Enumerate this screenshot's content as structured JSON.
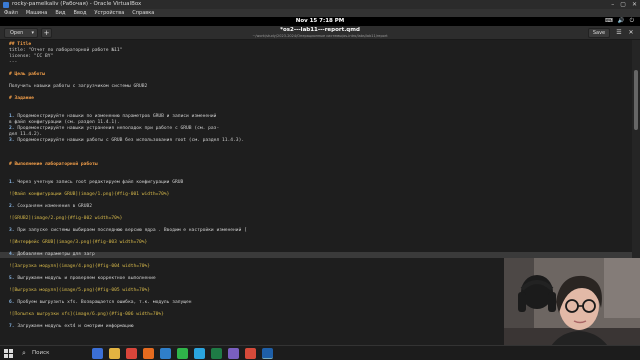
{
  "vbox": {
    "title": "rocky-pamelkaliv (Рабочая) - Oracle VirtualBox",
    "menu": [
      "Файл",
      "Машина",
      "Вид",
      "Ввод",
      "Устройства",
      "Справка"
    ],
    "controls": [
      "–",
      "▢",
      "✕"
    ]
  },
  "gnome": {
    "clock": "Nov 15  7:18 PM",
    "tray": [
      "⌨",
      "🔊",
      "⏻"
    ]
  },
  "gedit": {
    "open_label": "Open",
    "title": "*os2---lab11---report.qmd",
    "path": "~/work/study/2023-2024/Операционные системы/os-intro/labs/lab11/report",
    "save_label": "Save"
  },
  "editor_lines": [
    {
      "parts": [
        {
          "t": "## Title",
          "c": "heading"
        }
      ]
    },
    {
      "parts": [
        {
          "t": "title: \"Отчет по лабораторной работе №11\"",
          "c": ""
        }
      ]
    },
    {
      "parts": [
        {
          "t": "license: \"CC BY\"",
          "c": ""
        }
      ]
    },
    {
      "parts": [
        {
          "t": "---",
          "c": ""
        }
      ]
    },
    {
      "parts": []
    },
    {
      "parts": [
        {
          "t": "# Цель работы",
          "c": "heading"
        }
      ]
    },
    {
      "parts": []
    },
    {
      "parts": [
        {
          "t": "Получить навыки работы с загрузчиком системы GRUB2",
          "c": ""
        }
      ]
    },
    {
      "parts": []
    },
    {
      "parts": [
        {
          "t": "# Задание",
          "c": "heading"
        }
      ]
    },
    {
      "parts": []
    },
    {
      "parts": []
    },
    {
      "parts": [
        {
          "t": "1. ",
          "c": "num"
        },
        {
          "t": "Продемонстрируйте навыки по изменению параметров GRUB и записи изменений",
          "c": ""
        }
      ]
    },
    {
      "parts": [
        {
          "t": "в файл конфигурации (см. раздел 11.4.1).",
          "c": ""
        }
      ]
    },
    {
      "parts": [
        {
          "t": "2. ",
          "c": "num"
        },
        {
          "t": "Продемонстрируйте навыки устранения неполадок при работе с GRUB (см. раз-",
          "c": ""
        }
      ]
    },
    {
      "parts": [
        {
          "t": "дел 11.4.2).",
          "c": ""
        }
      ]
    },
    {
      "parts": [
        {
          "t": "3. ",
          "c": "num"
        },
        {
          "t": "Продемонстрируйте навыки работы с GRUB без использования root (см. раздел 11.4.3).",
          "c": ""
        }
      ]
    },
    {
      "parts": []
    },
    {
      "parts": []
    },
    {
      "parts": []
    },
    {
      "parts": [
        {
          "t": "# Выполнение лабораторной работы",
          "c": "heading"
        }
      ]
    },
    {
      "parts": []
    },
    {
      "parts": []
    },
    {
      "parts": [
        {
          "t": "1. ",
          "c": "num"
        },
        {
          "t": "Через учетную запись root редактируем файл конфигурации GRUB",
          "c": ""
        }
      ]
    },
    {
      "parts": []
    },
    {
      "parts": [
        {
          "t": "![Файл конфигурации GRUB](image/1.png){#fig-001 width=70%}",
          "c": "linktxt"
        }
      ]
    },
    {
      "parts": []
    },
    {
      "parts": [
        {
          "t": "2. ",
          "c": "num"
        },
        {
          "t": "Сохраняем изменения в GRUB2",
          "c": ""
        }
      ]
    },
    {
      "parts": []
    },
    {
      "parts": [
        {
          "t": "![GRUB2](image/2.png){#fig-002 width=70%}",
          "c": "linktxt"
        }
      ]
    },
    {
      "parts": []
    },
    {
      "parts": [
        {
          "t": "3. ",
          "c": "num"
        },
        {
          "t": "При запуске системы выбираем последнюю версию ядра . Вводим e настройки изменений [",
          "c": ""
        }
      ]
    },
    {
      "parts": []
    },
    {
      "parts": [
        {
          "t": "![Интерфейс GRUB](image/3.png){#fig-003 width=70%}",
          "c": "linktxt"
        }
      ]
    },
    {
      "parts": []
    },
    {
      "parts": [
        {
          "t": "4. ",
          "c": "num"
        },
        {
          "t": "Добавляем параметры для загр",
          "c": ""
        }
      ],
      "hl": true
    },
    {
      "parts": []
    },
    {
      "parts": [
        {
          "t": "![Загрузка модуля](image/4.png){#fig-004 width=70%}",
          "c": "linktxt"
        }
      ]
    },
    {
      "parts": []
    },
    {
      "parts": [
        {
          "t": "5. ",
          "c": "num"
        },
        {
          "t": "Выгружаем модуль и проверяем корректное выполнение",
          "c": ""
        }
      ]
    },
    {
      "parts": []
    },
    {
      "parts": [
        {
          "t": "![Выгрузка модуля](image/5.png){#fig-005 width=70%}",
          "c": "linktxt"
        }
      ]
    },
    {
      "parts": []
    },
    {
      "parts": [
        {
          "t": "6. ",
          "c": "num"
        },
        {
          "t": "Пробуем выгрузить xfs. Возвращается ошибка, т.к. модуль запущен",
          "c": ""
        }
      ]
    },
    {
      "parts": []
    },
    {
      "parts": [
        {
          "t": "![Попытка выгрузки xfs](image/6.png){#fig-006 width=70%}",
          "c": "linktxt"
        }
      ]
    },
    {
      "parts": []
    },
    {
      "parts": [
        {
          "t": "7. ",
          "c": "num"
        },
        {
          "t": "Загружаем модуль ext4 и смотрим информацию",
          "c": ""
        }
      ]
    }
  ],
  "taskbar": {
    "search_label": "Поиск",
    "apps": [
      {
        "icon": "globe-icon",
        "color": "#3b6fd6"
      },
      {
        "icon": "folder-icon",
        "color": "#e3b341"
      },
      {
        "icon": "chrome-icon",
        "color": "#d9453a"
      },
      {
        "icon": "firefox-icon",
        "color": "#e66b1f"
      },
      {
        "icon": "code-icon",
        "color": "#2f7fc9"
      },
      {
        "icon": "whatsapp-icon",
        "color": "#2fb54a"
      },
      {
        "icon": "telegram-icon",
        "color": "#2aa4de"
      },
      {
        "icon": "excel-icon",
        "color": "#1e7b45"
      },
      {
        "icon": "app-icon",
        "color": "#7a5fc0"
      },
      {
        "icon": "media-icon",
        "color": "#d64a3a"
      },
      {
        "icon": "virtualbox-icon",
        "color": "#1e5fa8"
      }
    ]
  }
}
